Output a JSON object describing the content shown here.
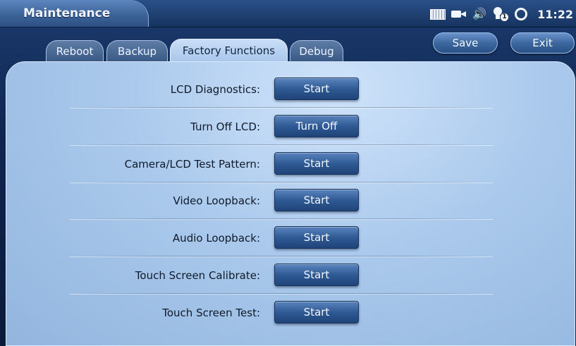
{
  "header": {
    "title": "Maintenance",
    "time": "11:22",
    "status_icons": [
      "keyboard-icon",
      "camera-icon",
      "speaker-icon",
      "bulb-icon",
      "sync-icon"
    ],
    "bulb_badge": "1"
  },
  "tabs": [
    {
      "label": "Reboot",
      "active": false
    },
    {
      "label": "Backup",
      "active": false
    },
    {
      "label": "Factory Functions",
      "active": true
    },
    {
      "label": "Debug",
      "active": false
    }
  ],
  "actions": {
    "save_label": "Save",
    "exit_label": "Exit"
  },
  "rows": [
    {
      "label": "LCD Diagnostics:",
      "button": "Start"
    },
    {
      "label": "Turn Off LCD:",
      "button": "Turn Off"
    },
    {
      "label": "Camera/LCD Test Pattern:",
      "button": "Start"
    },
    {
      "label": "Video Loopback:",
      "button": "Start"
    },
    {
      "label": "Audio Loopback:",
      "button": "Start"
    },
    {
      "label": "Touch Screen Calibrate:",
      "button": "Start"
    },
    {
      "label": "Touch Screen Test:",
      "button": "Start"
    }
  ],
  "colors": {
    "panel": "#aac9ec",
    "button": "#2f5a94",
    "active_tab": "#b8d3f1"
  }
}
